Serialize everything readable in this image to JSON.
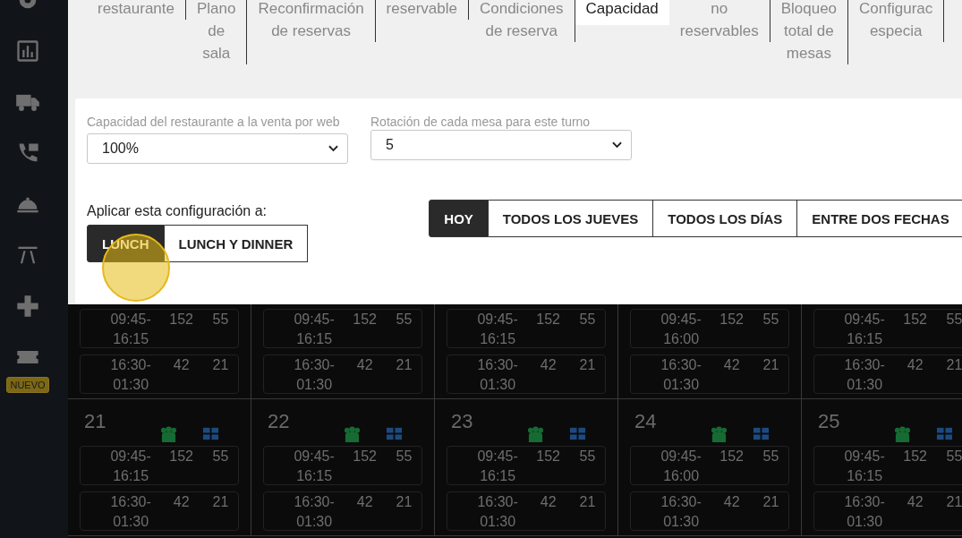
{
  "sidebar": {
    "badge": "NUEVO"
  },
  "dialog": {
    "tabs": [
      {
        "label": "restaurante",
        "selected": false
      },
      {
        "label": "Plano\nde\nsala",
        "selected": false
      },
      {
        "label": "Reconfirmación\nde reservas",
        "selected": false
      },
      {
        "label": "reservable",
        "selected": false
      },
      {
        "label": "Condiciones\nde reserva",
        "selected": false
      },
      {
        "label": "Capacidad",
        "selected": true
      },
      {
        "label": "no\nreservables",
        "selected": false
      },
      {
        "label": "Bloqueo\ntotal de\nmesas",
        "selected": false
      },
      {
        "label": "Configurac\nespecia",
        "selected": false
      }
    ],
    "fields": [
      {
        "label": "Capacidad del restaurante a la venta por web",
        "value": "100%"
      },
      {
        "label": "Rotación de cada mesa para este turno",
        "value": "5"
      }
    ],
    "apply_label": "Aplicar esta configuración a:",
    "shift_buttons": [
      {
        "label": "LUNCH",
        "selected": true
      },
      {
        "label": "LUNCH Y DINNER",
        "selected": false
      }
    ],
    "range_buttons": [
      {
        "label": "HOY",
        "selected": true
      },
      {
        "label": "TODOS LOS JUEVES",
        "selected": false
      },
      {
        "label": "TODOS LOS DÍAS",
        "selected": false
      },
      {
        "label": "ENTRE DOS FECHAS",
        "selected": false
      }
    ]
  },
  "calendar": {
    "weeks": [
      [
        {
          "shifts": [
            {
              "time": "09:45-16:15",
              "covers": "152",
              "tables": "55"
            },
            {
              "time": "16:30-01:30",
              "covers": "42",
              "tables": "21"
            }
          ]
        },
        {
          "shifts": [
            {
              "time": "09:45-16:15",
              "covers": "152",
              "tables": "55"
            },
            {
              "time": "16:30-01:30",
              "covers": "42",
              "tables": "21"
            }
          ]
        },
        {
          "shifts": [
            {
              "time": "09:45-16:15",
              "covers": "152",
              "tables": "55"
            },
            {
              "time": "16:30-01:30",
              "covers": "42",
              "tables": "21"
            }
          ]
        },
        {
          "shifts": [
            {
              "time": "09:45-16:00",
              "covers": "152",
              "tables": "55"
            },
            {
              "time": "16:30-01:30",
              "covers": "42",
              "tables": "21"
            }
          ]
        },
        {
          "shifts": [
            {
              "time": "09:45-16:15",
              "covers": "152",
              "tables": "55"
            },
            {
              "time": "16:30-01:30",
              "covers": "42",
              "tables": "21"
            }
          ]
        }
      ],
      [
        {
          "day": "21",
          "shifts": [
            {
              "time": "09:45-16:15",
              "covers": "152",
              "tables": "55"
            },
            {
              "time": "16:30-01:30",
              "covers": "42",
              "tables": "21"
            }
          ]
        },
        {
          "day": "22",
          "shifts": [
            {
              "time": "09:45-16:15",
              "covers": "152",
              "tables": "55"
            },
            {
              "time": "16:30-01:30",
              "covers": "42",
              "tables": "21"
            }
          ]
        },
        {
          "day": "23",
          "shifts": [
            {
              "time": "09:45-16:15",
              "covers": "152",
              "tables": "55"
            },
            {
              "time": "16:30-01:30",
              "covers": "42",
              "tables": "21"
            }
          ]
        },
        {
          "day": "24",
          "shifts": [
            {
              "time": "09:45-16:00",
              "covers": "152",
              "tables": "55"
            },
            {
              "time": "16:30-01:30",
              "covers": "42",
              "tables": "21"
            }
          ]
        },
        {
          "day": "25",
          "shifts": [
            {
              "time": "09:45-16:15",
              "covers": "152",
              "tables": "55"
            },
            {
              "time": "16:30-01:30",
              "covers": "42",
              "tables": "21"
            }
          ]
        }
      ]
    ]
  }
}
